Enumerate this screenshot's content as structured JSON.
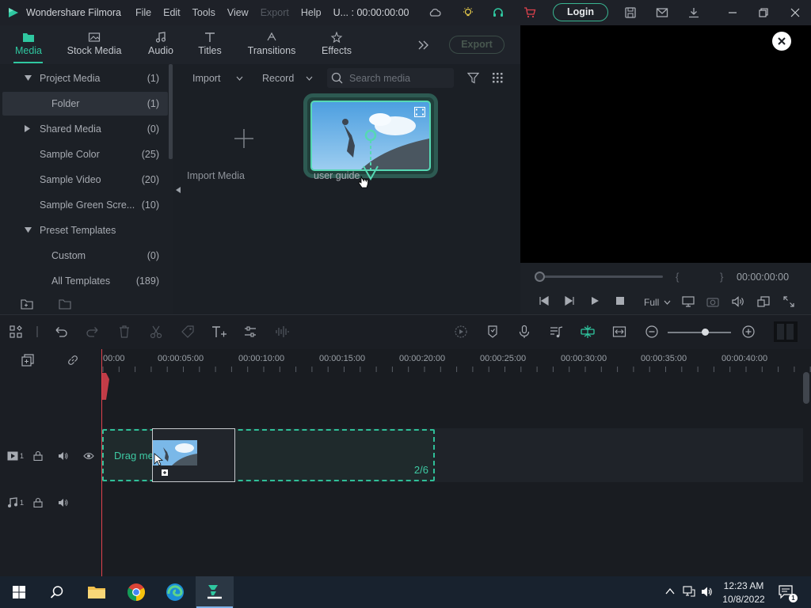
{
  "titlebar": {
    "app_name": "Wondershare Filmora",
    "menu": [
      "File",
      "Edit",
      "Tools",
      "View",
      "Export",
      "Help"
    ],
    "project_title": "U... : 00:00:00:00",
    "login_label": "Login"
  },
  "tabs": {
    "items": [
      {
        "label": "Media",
        "icon": "folder-icon",
        "active": true
      },
      {
        "label": "Stock Media",
        "icon": "stock-media-icon"
      },
      {
        "label": "Audio",
        "icon": "music-note-icon"
      },
      {
        "label": "Titles",
        "icon": "text-icon"
      },
      {
        "label": "Transitions",
        "icon": "transition-icon"
      },
      {
        "label": "Effects",
        "icon": "effects-icon"
      }
    ],
    "export_label": "Export"
  },
  "tree": {
    "items": [
      {
        "label": "Project Media",
        "count": "(1)"
      },
      {
        "label": "Folder",
        "count": "(1)"
      },
      {
        "label": "Shared Media",
        "count": "(0)"
      },
      {
        "label": "Sample Color",
        "count": "(25)"
      },
      {
        "label": "Sample Video",
        "count": "(20)"
      },
      {
        "label": "Sample Green Scre...",
        "count": "(10)"
      },
      {
        "label": "Preset Templates",
        "count": ""
      },
      {
        "label": "Custom",
        "count": "(0)"
      },
      {
        "label": "All Templates",
        "count": "(189)"
      }
    ]
  },
  "media": {
    "import_label": "Import",
    "record_label": "Record",
    "search_placeholder": "Search media",
    "import_media_label": "Import Media",
    "clip_name": "user guide"
  },
  "preview": {
    "timecode": "00:00:00:00",
    "quality": "Full"
  },
  "timeline": {
    "ruler_labels": [
      "00:00",
      "00:00:05:00",
      "00:00:10:00",
      "00:00:15:00",
      "00:00:20:00",
      "00:00:25:00",
      "00:00:30:00",
      "00:00:35:00",
      "00:00:40:00"
    ],
    "drop_text": "Drag media to edit it",
    "drop_count": "2/6",
    "video_track_num": "1",
    "audio_track_num": "1"
  },
  "taskbar": {
    "time": "12:23 AM",
    "date": "10/8/2022",
    "notification_count": "1"
  },
  "colors": {
    "accent": "#2fc7a0",
    "playhead": "#e0424d",
    "background": "#1b1e24"
  }
}
